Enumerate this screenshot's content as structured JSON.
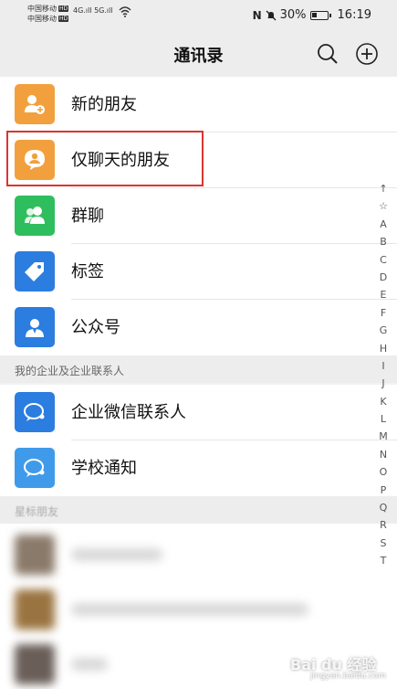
{
  "status_bar": {
    "carrier1": "中国移动",
    "carrier2": "中国移动",
    "hd": "HD",
    "signal1": "4G",
    "signal2": "5G",
    "battery_percent": "30%",
    "battery_level": 0.3,
    "time": "16:19"
  },
  "header": {
    "title": "通讯录"
  },
  "menu": {
    "new_friends": "新的朋友",
    "chat_only_friends": "仅聊天的朋友",
    "group_chats": "群聊",
    "tags": "标签",
    "official_accounts": "公众号"
  },
  "enterprise_section": {
    "title": "我的企业及企业联系人",
    "wecom_contacts": "企业微信联系人",
    "school_notice": "学校通知"
  },
  "starred_section": {
    "title": "星标朋友"
  },
  "index_bar": [
    "↑",
    "☆",
    "A",
    "B",
    "C",
    "D",
    "E",
    "F",
    "G",
    "H",
    "I",
    "J",
    "K",
    "L",
    "M",
    "N",
    "O",
    "P",
    "Q",
    "R",
    "S",
    "T"
  ],
  "watermark": {
    "text": "Bai du 经验",
    "sub": "jingyan.baidu.com"
  },
  "colors": {
    "orange": "#f2a03d",
    "green": "#2fbe5d",
    "blue": "#2b7de0",
    "light_blue": "#3f9bea",
    "highlight_red": "#d9362f"
  }
}
